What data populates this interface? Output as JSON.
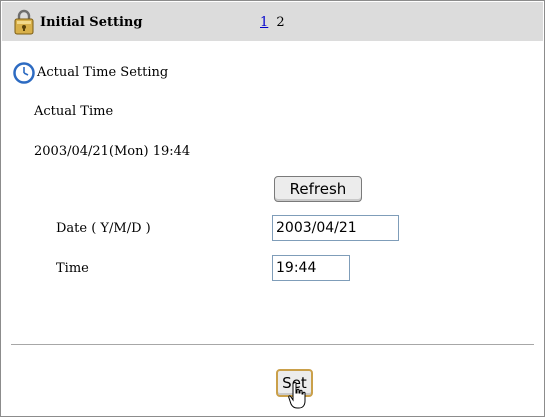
{
  "header": {
    "title": "Initial Setting",
    "pages": [
      "1",
      "2"
    ],
    "current_page": "2"
  },
  "section": {
    "title": "Actual Time Setting"
  },
  "actual_time": {
    "label": "Actual Time",
    "value": "2003/04/21(Mon) 19:44"
  },
  "buttons": {
    "refresh": "Refresh",
    "set": "Set"
  },
  "form": {
    "date_label": "Date ( Y/M/D )",
    "date_value": "2003/04/21",
    "time_label": "Time",
    "time_value": "19:44"
  },
  "icons": {
    "header": "lock-icon",
    "section": "clock-icon",
    "pointer": "hand-cursor-icon"
  }
}
